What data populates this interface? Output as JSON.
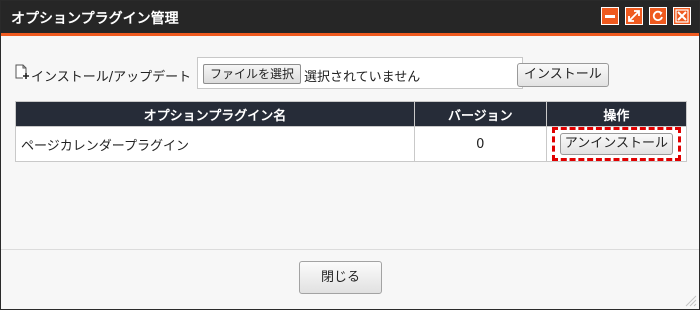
{
  "window": {
    "title": "オプションプラグイン管理",
    "buttons": [
      "minimize-icon",
      "maximize-icon",
      "refresh-icon",
      "close-icon"
    ],
    "accent_color": "#ef5a1f",
    "titlebar_color": "#262626"
  },
  "install": {
    "label": "インストール/アップデート",
    "choose_file_label": "ファイルを選択",
    "file_status": "選択されていません",
    "install_button": "インストール"
  },
  "table": {
    "headers": [
      "オプションプラグイン名",
      "バージョン",
      "操作"
    ],
    "header_color": "#262c38",
    "rows": [
      {
        "name": "ページカレンダープラグイン",
        "version": "0",
        "action": "アンインストール"
      }
    ]
  },
  "footer": {
    "close_button": "閉じる"
  },
  "highlight_color": "#e00000"
}
